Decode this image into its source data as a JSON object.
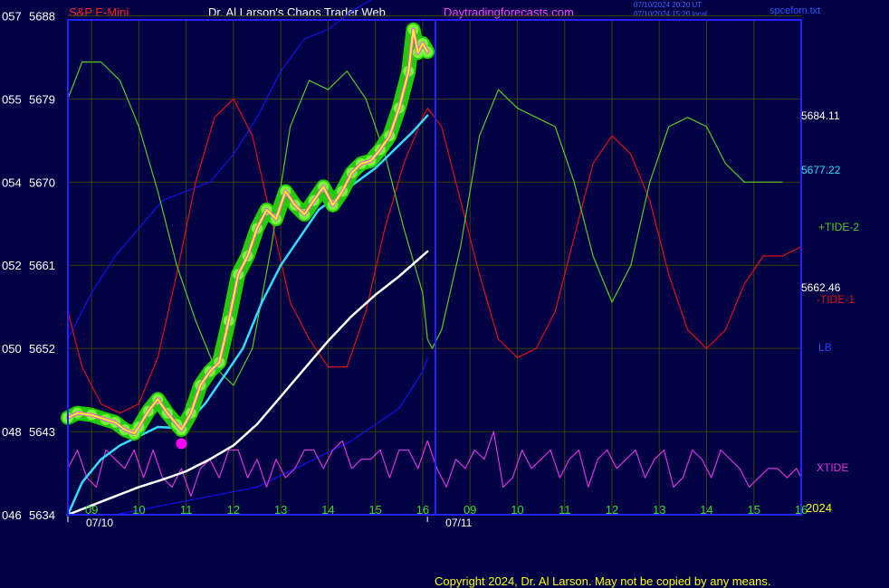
{
  "header": {
    "symbol": "S&P E-Mini",
    "brand": "Dr. Al Larson's Chaos Trader Web",
    "site": "Daytradingforecasts.com",
    "stamp_ut": "07/10/2024 20:20 UT",
    "stamp_local": "07/10/2024 15:20 local",
    "filename": "spcefom.txt"
  },
  "footer": {
    "copyright": "Copyright 2024, Dr. Al Larson. May not be copied by any means."
  },
  "colors": {
    "background": "#000044",
    "frame": "#2222ff",
    "grid": "#404000",
    "price": "#ffff00",
    "price_inner": "#ff44ff",
    "glow": "#22cc00",
    "glow_light": "#88ff44",
    "ma_fast": "#33ddff",
    "ma_slow": "#ffffff",
    "lb": "#1111ee",
    "tide1": "#dd1111",
    "tide2": "#55cc22",
    "xtide": "#dd33dd",
    "marker": "#ff00ff"
  },
  "chart_data": {
    "type": "line",
    "x_axis": {
      "hours_day1": [
        "09",
        "10",
        "11",
        "12",
        "13",
        "14",
        "15",
        "16"
      ],
      "hours_day2": [
        "09",
        "10",
        "11",
        "12",
        "13",
        "14",
        "15",
        "16"
      ],
      "dates": [
        "07/10",
        "07/11"
      ],
      "year": "2024"
    },
    "y_axis": {
      "prices": [
        5634,
        5643,
        5652,
        5661,
        5670,
        5679,
        5688
      ],
      "prefix": [
        "046",
        "048",
        "050",
        "052",
        "054",
        "055",
        "057"
      ],
      "range": [
        5634,
        5688
      ]
    },
    "right_labels": {
      "last_price": "5684.11",
      "ma_fast_value": "5677.22",
      "ma_slow_value": "5662.46",
      "tide2": "+TIDE-2",
      "tide1": "-TIDE-1",
      "lb": "LB",
      "xtide": "XTIDE"
    },
    "price_series": {
      "name": "",
      "x": [
        8.5,
        8.7,
        9.0,
        9.3,
        9.5,
        9.7,
        9.9,
        10.0,
        10.2,
        10.4,
        10.6,
        10.8,
        10.9,
        11.1,
        11.3,
        11.5,
        11.7,
        11.9,
        12.1,
        12.3,
        12.5,
        12.7,
        12.9,
        13.1,
        13.3,
        13.5,
        13.7,
        13.9,
        14.1,
        14.3,
        14.5,
        14.7,
        14.9,
        15.1,
        15.3,
        15.5,
        15.7,
        15.8,
        15.9,
        16.0,
        16.1
      ],
      "y": [
        5644.5,
        5645,
        5644.8,
        5644.3,
        5644,
        5643.2,
        5642.8,
        5643.5,
        5645.2,
        5646.5,
        5645,
        5643.8,
        5643.2,
        5645,
        5648,
        5649.5,
        5650.5,
        5655,
        5660,
        5662,
        5665,
        5667,
        5666,
        5669,
        5667.5,
        5666.5,
        5668,
        5669.5,
        5667.5,
        5669,
        5671,
        5672,
        5672.3,
        5673.5,
        5675,
        5678,
        5682,
        5686.5,
        5684,
        5685,
        5684.1
      ]
    },
    "ma_fast": {
      "name": "",
      "x": [
        8.5,
        8.8,
        9.2,
        9.6,
        10.0,
        10.4,
        10.8,
        11.0,
        11.4,
        11.8,
        12.2,
        12.6,
        13.0,
        13.4,
        13.8,
        14.2,
        14.6,
        15.0,
        15.4,
        15.8,
        16.1
      ],
      "y": [
        5634,
        5637.5,
        5640,
        5641.5,
        5642.5,
        5643.5,
        5643.4,
        5643.8,
        5646,
        5649,
        5652,
        5657,
        5661,
        5664,
        5667,
        5668.5,
        5670,
        5671.5,
        5673.5,
        5675.5,
        5677.2
      ]
    },
    "ma_slow": {
      "name": "",
      "x": [
        8.5,
        9.0,
        9.5,
        10.0,
        10.5,
        11.0,
        11.5,
        12.0,
        12.5,
        13.0,
        13.5,
        14.0,
        14.5,
        15.0,
        15.5,
        16.1
      ],
      "y": [
        5634,
        5635,
        5636,
        5637,
        5637.8,
        5638.7,
        5640,
        5641.5,
        5643.8,
        5646.8,
        5649.8,
        5652.8,
        5655.5,
        5657.8,
        5659.8,
        5662.5
      ]
    },
    "lb": {
      "name": "LB",
      "x": [
        8.5,
        9.0,
        9.5,
        10.0,
        10.5,
        11.0,
        11.5,
        12.0,
        12.5,
        13.0,
        13.5,
        14.0,
        14.5,
        15.0,
        15.5,
        16.0,
        16.1
      ],
      "y": [
        5653,
        5658,
        5662,
        5665,
        5668,
        5669,
        5670,
        5673,
        5677,
        5682,
        5685.5,
        5686.5,
        5688.5,
        5690,
        5692,
        5694,
        5696
      ]
    },
    "lb_continued": {
      "name": "LB",
      "x": [
        9.5,
        10.5,
        11.5,
        12.5,
        13.5,
        14.5,
        15.5,
        16.0,
        16.1
      ],
      "y": [
        5634,
        5635,
        5636,
        5637,
        5639.5,
        5642,
        5645.5,
        5649.5,
        5651
      ]
    },
    "tide1": {
      "name": "-TIDE-1",
      "x": [
        8.5,
        8.8,
        9.2,
        9.6,
        10.0,
        10.4,
        10.8,
        11.2,
        11.6,
        12.0,
        12.4,
        12.8,
        13.2,
        13.6,
        14.0,
        14.4,
        14.8,
        15.2,
        15.6,
        16.0,
        16.1,
        16.4,
        16.8,
        17.2,
        17.6,
        18.0,
        18.4,
        18.8,
        19.2,
        19.6,
        20.0,
        20.4,
        20.8,
        21.2,
        21.6,
        22.0,
        22.4,
        22.8,
        23.2,
        23.6,
        24.0
      ],
      "y": [
        5656,
        5650,
        5646,
        5645,
        5646,
        5651,
        5660,
        5670,
        5677,
        5679,
        5675,
        5666,
        5657,
        5653,
        5650,
        5650,
        5656,
        5665,
        5672,
        5677,
        5678,
        5676,
        5668,
        5660,
        5653,
        5651,
        5652,
        5656,
        5664,
        5672,
        5675,
        5673,
        5668,
        5660,
        5654,
        5652,
        5654,
        5659,
        5662,
        5662,
        5663
      ]
    },
    "tide2": {
      "name": "+TIDE-2",
      "x": [
        8.5,
        8.8,
        9.2,
        9.6,
        10.0,
        10.4,
        10.8,
        11.2,
        11.6,
        12.0,
        12.4,
        12.8,
        13.2,
        13.6,
        14.0,
        14.4,
        14.8,
        15.2,
        15.6,
        16.0,
        16.1,
        16.2,
        16.4,
        16.8,
        17.2,
        17.6,
        18.0,
        18.4,
        18.8,
        19.2,
        19.6,
        20.0,
        20.4,
        20.8,
        21.2,
        21.6,
        22.0,
        22.4,
        22.8,
        23.2,
        23.6,
        24.0
      ],
      "y": [
        5679,
        5683,
        5683,
        5681,
        5676,
        5669,
        5661,
        5655,
        5650,
        5648,
        5652,
        5663,
        5676,
        5681,
        5680,
        5682,
        5679,
        5673,
        5665,
        5658,
        5653,
        5652,
        5654,
        5663,
        5675,
        5680,
        5678,
        5677,
        5676,
        5670,
        5662,
        5657,
        5661,
        5670,
        5676,
        5677,
        5676,
        5672,
        5670,
        5670,
        5670
      ]
    },
    "xtide": {
      "name": "XTIDE",
      "x": [
        8.5,
        8.7,
        8.9,
        9.1,
        9.3,
        9.5,
        9.7,
        9.9,
        10.1,
        10.3,
        10.5,
        10.7,
        10.9,
        11.1,
        11.3,
        11.5,
        11.7,
        11.9,
        12.1,
        12.3,
        12.5,
        12.7,
        12.9,
        13.1,
        13.3,
        13.5,
        13.7,
        13.9,
        14.1,
        14.3,
        14.5,
        14.7,
        14.9,
        15.1,
        15.3,
        15.5,
        15.7,
        15.9,
        16.1,
        16.3,
        16.5,
        16.7,
        16.9,
        17.1,
        17.3,
        17.5,
        17.7,
        17.9,
        18.1,
        18.3,
        18.5,
        18.7,
        18.9,
        19.1,
        19.3,
        19.5,
        19.7,
        19.9,
        20.1,
        20.3,
        20.5,
        20.7,
        20.9,
        21.1,
        21.3,
        21.5,
        21.7,
        21.9,
        22.1,
        22.3,
        22.5,
        22.7,
        22.9,
        23.1,
        23.3,
        23.5,
        23.7,
        23.9,
        24.0
      ],
      "y": [
        5639,
        5641,
        5638,
        5637,
        5641,
        5640,
        5639,
        5641,
        5638,
        5641,
        5638,
        5637,
        5639,
        5636,
        5639,
        5640,
        5638,
        5641,
        5641,
        5638,
        5640,
        5637,
        5640,
        5638,
        5639,
        5641,
        5641,
        5639,
        5641,
        5642,
        5639,
        5640,
        5640,
        5641,
        5638,
        5641,
        5641,
        5639,
        5642,
        5639,
        5637,
        5640,
        5639,
        5641,
        5640,
        5643,
        5637,
        5638,
        5641,
        5639,
        5640,
        5641,
        5638,
        5640,
        5641,
        5637,
        5640,
        5641,
        5639,
        5640,
        5641,
        5638,
        5640,
        5641,
        5637,
        5638,
        5641,
        5640,
        5638,
        5641,
        5640,
        5639,
        5637,
        5638,
        5639,
        5639,
        5638,
        5639,
        5638
      ]
    },
    "marker": {
      "x": 10.9,
      "y": 5641.7
    },
    "xlim": [
      8.5,
      24.0
    ]
  }
}
